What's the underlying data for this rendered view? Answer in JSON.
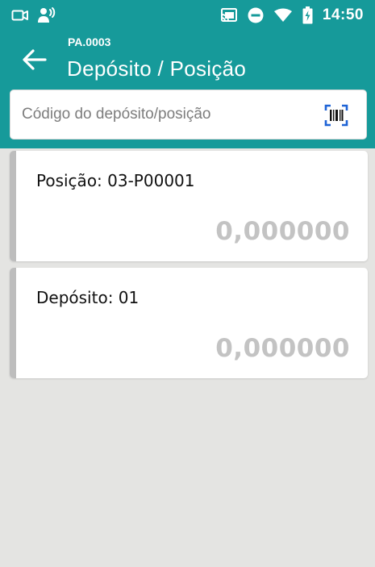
{
  "status_bar": {
    "time": "14:50",
    "left_icons": [
      "camera-record-icon",
      "broadcast-person-icon"
    ],
    "right_icons": [
      "cast-icon",
      "do-not-disturb-icon",
      "wifi-icon",
      "battery-charging-icon"
    ]
  },
  "header": {
    "subtitle": "PA.0003",
    "title": "Depósito / Posição",
    "back_icon": "arrow-left-icon",
    "color": "#169a9a"
  },
  "search": {
    "placeholder": "Código do depósito/posição",
    "value": "",
    "scan_icon": "barcode-scan-icon",
    "scan_icon_color": "#1e63d6"
  },
  "cards": [
    {
      "label": "Posição: 03-P00001",
      "value": "0,000000"
    },
    {
      "label": "Depósito: 01",
      "value": "0,000000"
    }
  ]
}
